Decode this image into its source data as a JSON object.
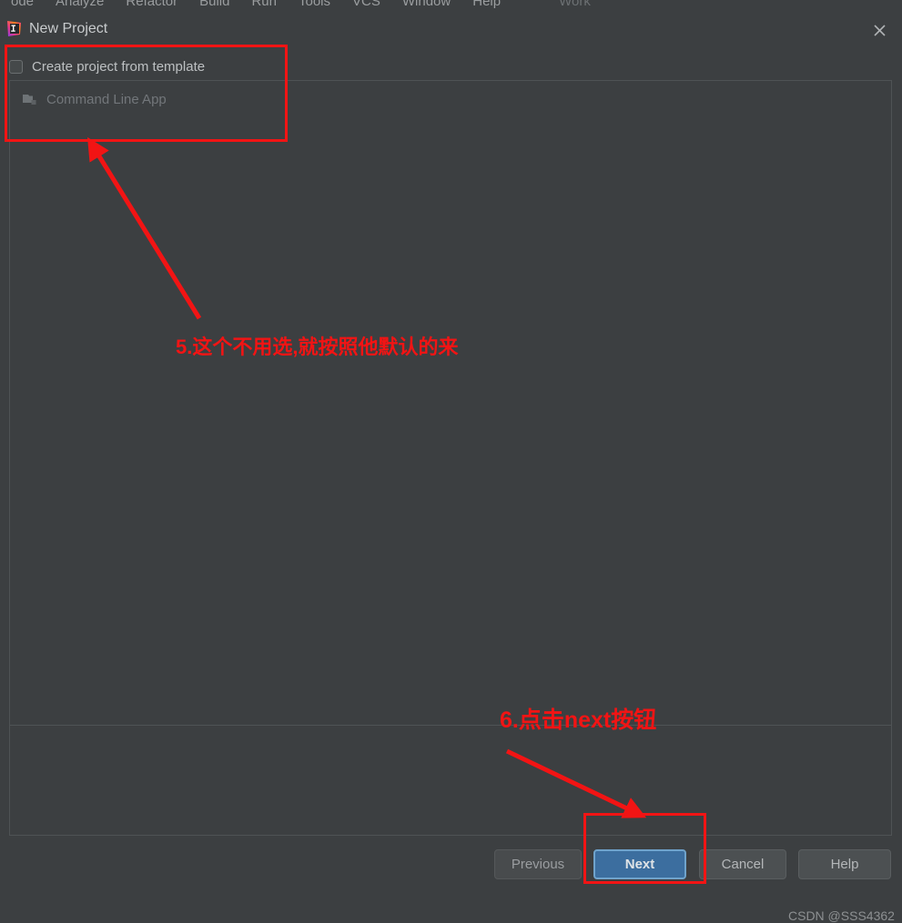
{
  "menubar": {
    "items": [
      {
        "label": "ode"
      },
      {
        "label": "Analyze"
      },
      {
        "label": "Refactor"
      },
      {
        "label": "Build"
      },
      {
        "label": "Run"
      },
      {
        "label": "Tools"
      },
      {
        "label": "VCS"
      },
      {
        "label": "Window"
      },
      {
        "label": "Help"
      }
    ],
    "trailing_label": "Work"
  },
  "dialog": {
    "title": "New Project",
    "app_icon": "intellij-idea-icon",
    "close_icon": "close-icon"
  },
  "template": {
    "checkbox_label": "Create project from template",
    "checkbox_checked": false,
    "list": [
      {
        "label": "Command Line App",
        "icon": "module-folder-icon",
        "enabled": false
      }
    ]
  },
  "buttons": {
    "previous": "Previous",
    "next": "Next",
    "cancel": "Cancel",
    "help": "Help"
  },
  "annotations": {
    "step5_text": "5.这个不用选,就按照他默认的来",
    "step6_text": "6.点击next按钮",
    "accent_color": "#f21414"
  },
  "watermark": {
    "text": "CSDN @SSS4362"
  },
  "colors": {
    "background": "#3c3f41",
    "panel_border": "#4f5355",
    "primary_button": "#3c6e9f",
    "primary_button_border": "#6fa3cc",
    "text": "#bbbbbb",
    "disabled_text": "#72767a"
  }
}
